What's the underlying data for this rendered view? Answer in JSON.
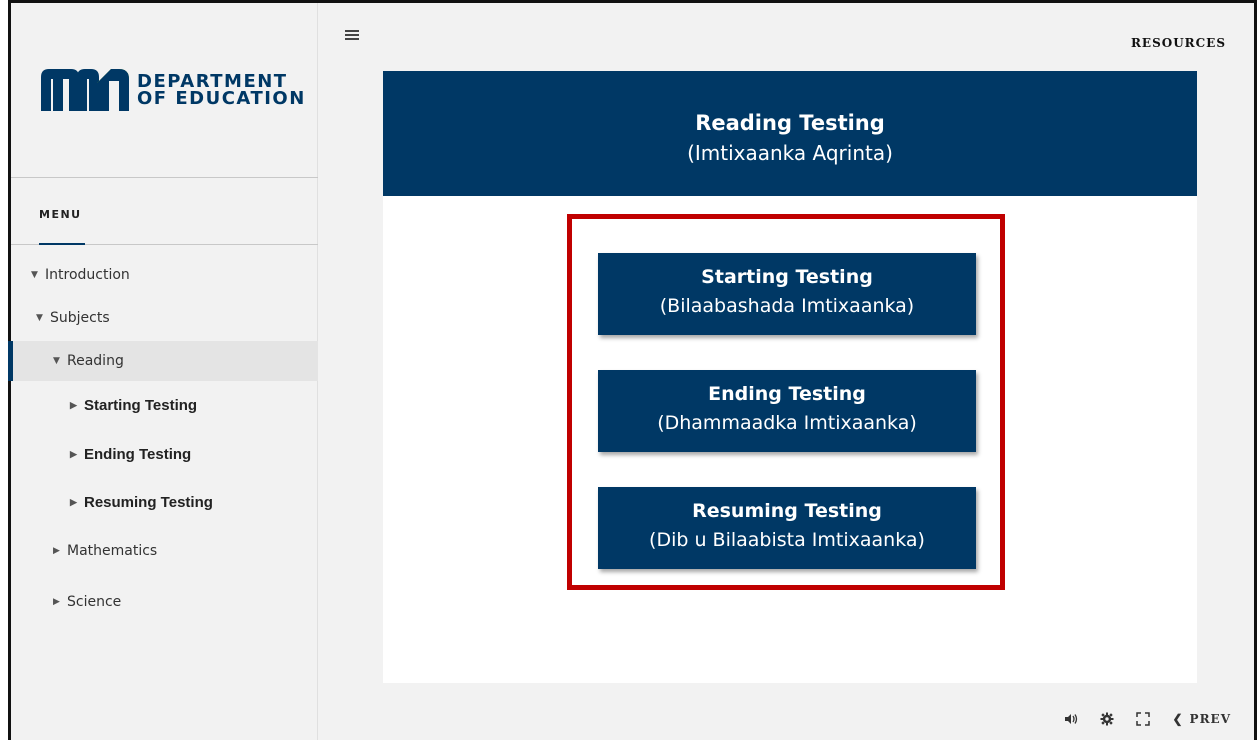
{
  "brand": {
    "logo_line1": "DEPARTMENT",
    "logo_line2": "OF EDUCATION",
    "primary_color": "#003865",
    "highlight_color": "#c00000"
  },
  "sidebar": {
    "menu_label": "MENU",
    "items": [
      {
        "label": "Introduction",
        "icon": "caret-down-icon"
      },
      {
        "label": "Subjects",
        "icon": "caret-down-icon"
      },
      {
        "label": "Reading",
        "icon": "caret-down-icon",
        "active": true
      },
      {
        "label": "Starting Testing",
        "icon": "caret-right-icon"
      },
      {
        "label": "Ending Testing",
        "icon": "caret-right-icon"
      },
      {
        "label": "Resuming Testing",
        "icon": "caret-right-icon"
      },
      {
        "label": "Mathematics",
        "icon": "caret-right-icon"
      },
      {
        "label": "Science",
        "icon": "caret-right-icon"
      }
    ]
  },
  "topbar": {
    "resources_label": "RESOURCES",
    "menu_icon": "hamburger-icon"
  },
  "header": {
    "title": "Reading Testing",
    "subtitle": "(Imtixaanka Aqrinta)"
  },
  "buttons": [
    {
      "title": "Starting Testing",
      "subtitle": "(Bilaabashada Imtixaanka)"
    },
    {
      "title": "Ending Testing",
      "subtitle": "(Dhammaadka Imtixaanka)"
    },
    {
      "title": "Resuming Testing",
      "subtitle": "(Dib u Bilaabista Imtixaanka)"
    }
  ],
  "footer": {
    "audio_icon": "audio-icon",
    "settings_icon": "gear-icon",
    "fullscreen_icon": "fullscreen-icon",
    "prev_label": "PREV"
  }
}
